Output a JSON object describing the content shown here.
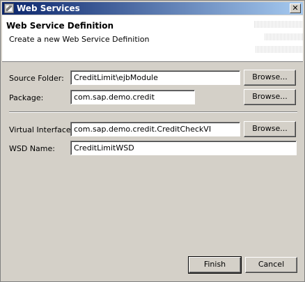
{
  "window": {
    "title": "Web Services",
    "close_glyph": "✕"
  },
  "header": {
    "title": "Web Service Definition",
    "description": "Create a new Web Service Definition"
  },
  "form": {
    "source_folder": {
      "label": "Source Folder:",
      "value": "CreditLimit\\ejbModule",
      "browse_label": "Browse..."
    },
    "package": {
      "label": "Package:",
      "value": "com.sap.demo.credit",
      "browse_label": "Browse..."
    },
    "virtual_interface": {
      "label": "Virtual Interface:",
      "value": "com.sap.demo.credit.CreditCheckVI",
      "browse_label": "Browse..."
    },
    "wsd_name": {
      "label": "WSD Name:",
      "value": "CreditLimitWSD"
    }
  },
  "footer": {
    "finish_label": "Finish",
    "cancel_label": "Cancel"
  }
}
